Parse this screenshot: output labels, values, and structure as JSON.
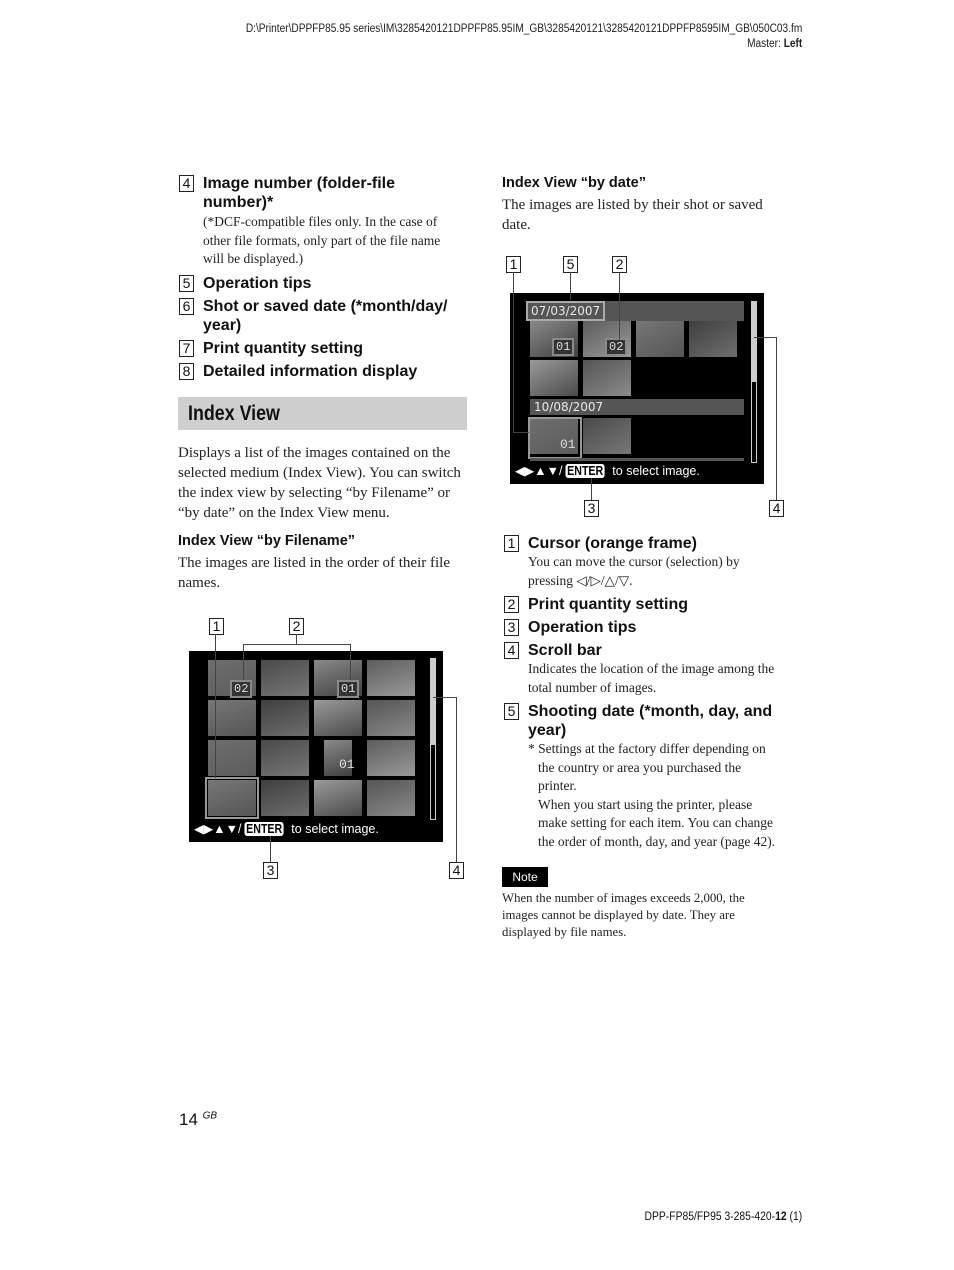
{
  "header": {
    "path": "D:\\Printer\\DPPFP85.95 series\\IM\\3285420121DPPFP85.95IM_GB\\3285420121\\3285420121DPPFP8595IM_GB\\050C03.fm",
    "master_label": "Master: ",
    "master_value": "Left"
  },
  "left_items": [
    {
      "num": "4",
      "title_l1": "Image number (folder-file",
      "title_l2": "number)*",
      "desc": [
        "(*DCF-compatible files only. In the case of",
        "other file formats, only part of the file name",
        "will be displayed.)"
      ]
    },
    {
      "num": "5",
      "title_l1": "Operation tips"
    },
    {
      "num": "6",
      "title_l1": "Shot or saved date (*month/day/",
      "title_l2": "year)"
    },
    {
      "num": "7",
      "title_l1": "Print quantity setting"
    },
    {
      "num": "8",
      "title_l1": "Detailed information display"
    }
  ],
  "section": {
    "title": "Index View",
    "intro": [
      "Displays a list of the images contained on the",
      "selected medium (Index View). You can switch",
      "the index view by selecting “by Filename” or",
      "“by date” on the Index View menu."
    ]
  },
  "by_filename": {
    "heading": "Index View “by Filename”",
    "text": [
      "The images are listed in the order of their file",
      "names."
    ],
    "callouts": [
      "1",
      "2",
      "3",
      "4"
    ],
    "screen": {
      "qty_a": "02",
      "qty_b": "01",
      "image_num": "01",
      "tips_arrows": "◀▶▲▼/",
      "tips_enter": "ENTER",
      "tips_text": " to select image.",
      "scroll_position": 0.6
    }
  },
  "by_date": {
    "heading": "Index View “by date”",
    "text": [
      "The images are listed by their shot or saved",
      "date."
    ],
    "callouts": [
      "1",
      "5",
      "2",
      "3",
      "4"
    ],
    "screen": {
      "date1": "07/03/2007",
      "date2": "10/08/2007",
      "qty_a": "01",
      "qty_b": "02",
      "image_num": "01",
      "tips_arrows": "◀▶▲▼/",
      "tips_enter": "ENTER",
      "tips_text": " to select image.",
      "scroll_position": 0.5
    }
  },
  "right_items": [
    {
      "num": "1",
      "title_l1": "Cursor (orange frame)",
      "desc": [
        "You can move the cursor (selection) by",
        "pressing ◁/▷/△/▽."
      ]
    },
    {
      "num": "2",
      "title_l1": "Print quantity setting"
    },
    {
      "num": "3",
      "title_l1": "Operation tips"
    },
    {
      "num": "4",
      "title_l1": "Scroll bar",
      "desc": [
        "Indicates the location of the image among the",
        "total number of images."
      ]
    },
    {
      "num": "5",
      "title_l1": "Shooting date (*month, day, and",
      "title_l2": "year)",
      "desc": [
        "* Settings at the factory differ depending on",
        "the country or area you purchased the",
        "printer.",
        "When you start using the printer, please",
        "make setting for each item. You can change",
        "the order of month, day, and year (page 42)."
      ]
    }
  ],
  "note": {
    "label": "Note",
    "text": [
      "When the number of images exceeds 2,000, the",
      "images cannot be displayed by date. They are",
      "displayed by file names."
    ]
  },
  "footer": {
    "page_number": "14",
    "page_suffix": "GB",
    "model_prefix": "DPP-FP85/FP95 3-285-420-",
    "model_bold": "12",
    "model_suffix": " (1)"
  }
}
